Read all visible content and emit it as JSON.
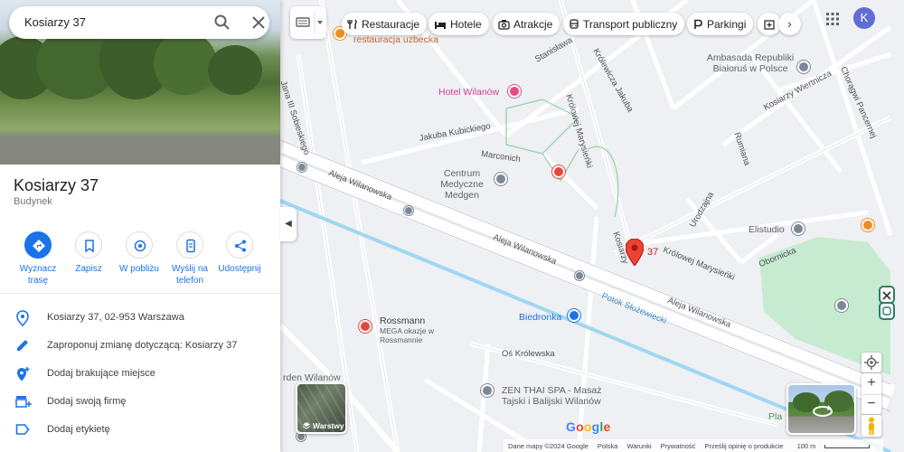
{
  "search": {
    "value": "Kosiarzy 37"
  },
  "place": {
    "title": "Kosiarzy 37",
    "type": "Budynek"
  },
  "actions": [
    {
      "label": "Wyznacz trasę",
      "icon": "directions-icon"
    },
    {
      "label": "Zapisz",
      "icon": "bookmark-icon"
    },
    {
      "label": "W pobliżu",
      "icon": "nearby-icon"
    },
    {
      "label": "Wyślij na telefon",
      "icon": "send-to-phone-icon"
    },
    {
      "label": "Udostępnij",
      "icon": "share-icon"
    }
  ],
  "info": [
    {
      "text": "Kosiarzy 37, 02-953 Warszawa",
      "icon": "location-pin-icon"
    },
    {
      "text": "Zaproponuj zmianę dotyczącą: Kosiarzy 37",
      "icon": "pencil-icon"
    },
    {
      "text": "Dodaj brakujące miejsce",
      "icon": "add-place-icon"
    },
    {
      "text": "Dodaj swoją firmę",
      "icon": "add-business-icon"
    },
    {
      "text": "Dodaj etykietę",
      "icon": "label-icon"
    }
  ],
  "chips": [
    {
      "label": "Restauracje",
      "icon": "restaurant-icon"
    },
    {
      "label": "Hotele",
      "icon": "hotel-icon"
    },
    {
      "label": "Atrakcje",
      "icon": "camera-icon"
    },
    {
      "label": "Transport publiczny",
      "icon": "transit-icon"
    },
    {
      "label": "Parkingi",
      "icon": "parking-icon"
    }
  ],
  "user": {
    "avatar_letter": "K"
  },
  "map": {
    "marker_label": "37",
    "labels": {
      "restaurant": "restauracja uzbecka",
      "hotel": "Hotel Wilanów",
      "embassy": "Ambasada Republiki Białoruś w Polsce",
      "medical": "Centrum Medyczne Medgen",
      "elistudio": "Elistudio",
      "biedronka": "Biedronka",
      "rossmann": "Rossmann",
      "rossmann_sub": "MEGA okazje w Rossmannie",
      "zen": "ZEN THAI SPA - Masaż Tajski i Balijski Wilanów",
      "garden": "rden Wilanów",
      "pla": "Pla"
    },
    "streets": {
      "sobieskiego": "Jana III Sobieskiego",
      "kubickiego": "Jakuba Kubickiego",
      "marconich": "Marconich",
      "wilanowska1": "Aleja Wilanowska",
      "wilanowska2": "Aleja Wilanowska",
      "wilanowska3": "Aleja Wilanowska",
      "marysienki1": "Królowej Marysieńki",
      "marysienki2": "Królowej Marysieńki",
      "kosiarzy": "Kosiarzy",
      "urodzajna": "Urodzajna",
      "obornicka": "Obornicka",
      "stanislawa": "Stanisława",
      "krolewicza": "Królewicza Jakuba",
      "wiertnicza": "Kosiarzy Wiertnicza",
      "rumiana": "Rumiana",
      "chorazych": "Chorągwi Pancernej",
      "sluzewiecki": "Potok Służewiecki",
      "oskrolewska": "Oś Królewska"
    }
  },
  "layers_label": "Warstwy",
  "google_logo": "Google",
  "footer": {
    "data": "Dane mapy ©2024 Google",
    "country": "Polska",
    "terms": "Warunki",
    "privacy": "Prywatność",
    "feedback": "Prześlij opinię o produkcie",
    "scale": "100 m"
  },
  "colors": {
    "accent": "#1a73e8",
    "marker": "#ea4335",
    "water": "#9fd7f3",
    "park": "#c7ebd0"
  }
}
